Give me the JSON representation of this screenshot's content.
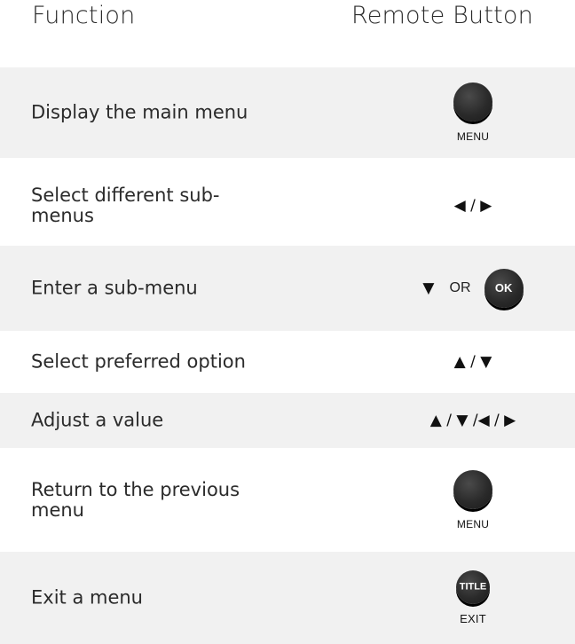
{
  "header": {
    "function_label": "Function",
    "button_label": "Remote Button"
  },
  "rows": [
    {
      "function": "Display the main menu",
      "button_caption": "MENU"
    },
    {
      "function": "Select different sub-menus",
      "arrows": "◀ / ▶"
    },
    {
      "function": "Enter a sub-menu",
      "arrow": "▼",
      "or": "OR",
      "button_text": "OK"
    },
    {
      "function": "Select preferred option",
      "arrows": "▲ / ▼"
    },
    {
      "function": "Adjust a value",
      "arrows": "▲ / ▼ /◀ / ▶"
    },
    {
      "function": "Return to the previous menu",
      "button_caption": "MENU"
    },
    {
      "function": "Exit a menu",
      "button_text": "TITLE",
      "button_caption": "EXIT"
    }
  ]
}
